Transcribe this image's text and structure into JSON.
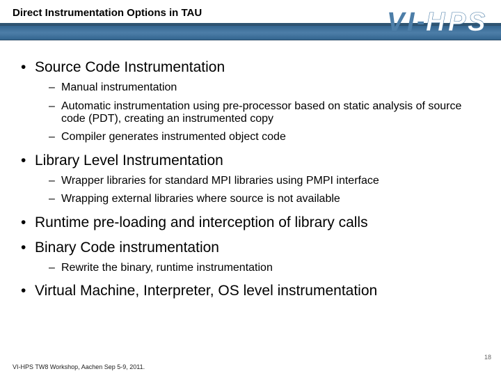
{
  "header": {
    "title": "Direct Instrumentation Options in TAU"
  },
  "logo": {
    "v": "V",
    "i": "I",
    "dash": "-",
    "h": "H",
    "p": "P",
    "s": "S"
  },
  "bullets": [
    {
      "level": 1,
      "text": "Source Code Instrumentation"
    },
    {
      "level": 2,
      "text": "Manual instrumentation"
    },
    {
      "level": 2,
      "text": "Automatic instrumentation using pre-processor based on static analysis of source code (PDT), creating an instrumented copy"
    },
    {
      "level": 2,
      "text": "Compiler generates instrumented object code"
    },
    {
      "level": 1,
      "text": "Library Level Instrumentation"
    },
    {
      "level": 2,
      "text": "Wrapper libraries for standard MPI libraries using PMPI interface"
    },
    {
      "level": 2,
      "text": "Wrapping external libraries where source is not available"
    },
    {
      "level": 1,
      "text": "Runtime pre-loading and interception of library calls"
    },
    {
      "level": 1,
      "text": "Binary Code instrumentation"
    },
    {
      "level": 2,
      "text": "Rewrite the binary, runtime instrumentation"
    },
    {
      "level": 1,
      "text": "Virtual Machine, Interpreter, OS level instrumentation"
    }
  ],
  "footer": {
    "text": "VI-HPS TW8 Workshop, Aachen Sep 5-9, 2011.",
    "page": "18"
  }
}
